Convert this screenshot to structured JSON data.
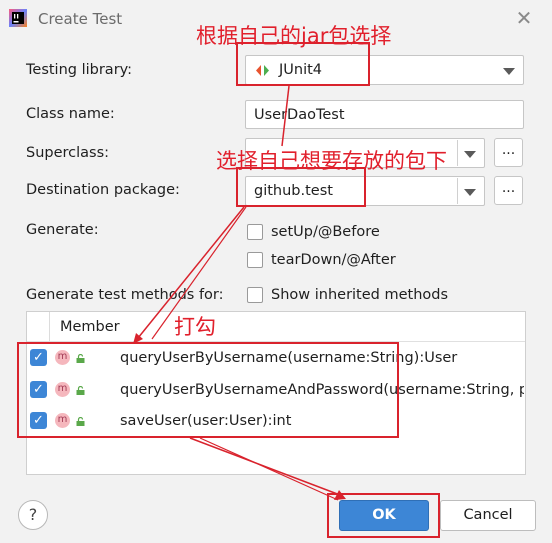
{
  "window": {
    "title": "Create Test",
    "close_symbol": "✕"
  },
  "form": {
    "testing_library": {
      "label": "Testing library:",
      "value": "JUnit4"
    },
    "class_name": {
      "label": "Class name:",
      "value": "UserDaoTest"
    },
    "superclass": {
      "label": "Superclass:",
      "value": "",
      "browse_label": "..."
    },
    "destination_package": {
      "label": "Destination package:",
      "value": "github.test",
      "browse_label": "..."
    },
    "generate": {
      "label": "Generate:",
      "options": [
        {
          "label": "setUp/@Before",
          "checked": false
        },
        {
          "label": "tearDown/@After",
          "checked": false
        }
      ]
    },
    "generate_methods_for": {
      "label": "Generate test methods for:"
    },
    "show_inherited": {
      "label": "Show inherited methods",
      "checked": false
    }
  },
  "members_table": {
    "header": "Member",
    "rows": [
      {
        "checked": true,
        "badge": "m",
        "signature": "queryUserByUsername(username:String):User"
      },
      {
        "checked": true,
        "badge": "m",
        "signature": "queryUserByUsernameAndPassword(username:String, p"
      },
      {
        "checked": true,
        "badge": "m",
        "signature": "saveUser(user:User):int"
      }
    ]
  },
  "buttons": {
    "help": "?",
    "ok": "OK",
    "cancel": "Cancel"
  },
  "annotations": {
    "jar_note": "根据自己的jar包选择",
    "package_note": "选择自己想要存放的包下",
    "check_note": "打勾"
  },
  "colors": {
    "accent": "#3d86d6",
    "annotation": "#e1202c",
    "method_badge": "#f5b7bd",
    "lock": "#5aa84a"
  },
  "icons": {
    "app": "intellij-idea-icon",
    "library": "junit-icon",
    "method": "method-icon",
    "visibility": "public-lock-icon"
  }
}
